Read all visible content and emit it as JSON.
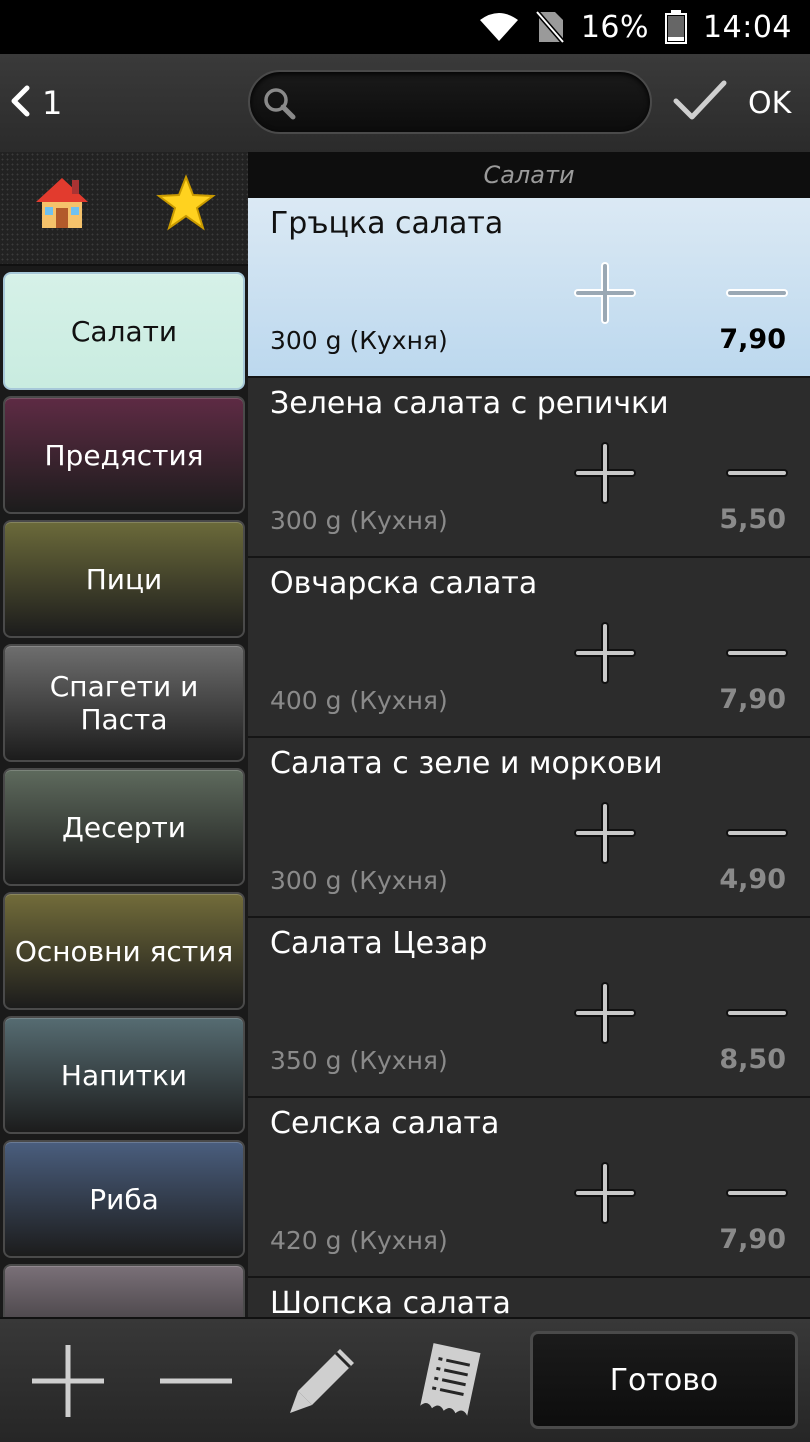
{
  "status_bar": {
    "battery": "16%",
    "time": "14:04"
  },
  "top_bar": {
    "back_count": "1",
    "search_placeholder": "",
    "search_value": "",
    "ok_label": "OK"
  },
  "quick": {
    "home_icon": "house-icon",
    "favorites_icon": "star-icon"
  },
  "categories": [
    {
      "label": "Салати",
      "active": true,
      "color": "#c9ece0"
    },
    {
      "label": "Предястия",
      "color": "#5e2b44"
    },
    {
      "label": "Пици",
      "color": "#6b6a3a"
    },
    {
      "label": "Спагети и Паста",
      "color": "#6e6e6e"
    },
    {
      "label": "Десерти",
      "color": "#5e6a5d"
    },
    {
      "label": "Основни ястия",
      "color": "#726c3a"
    },
    {
      "label": "Напитки",
      "color": "#566c72"
    },
    {
      "label": "Риба",
      "color": "#4a5e7e"
    },
    {
      "label": "",
      "color": "#7a7078"
    }
  ],
  "section": {
    "title": "Салати"
  },
  "items": [
    {
      "name": "Гръцка салата",
      "weight": "300 g (Кухня)",
      "price": "7,90",
      "selected": true
    },
    {
      "name": "Зелена салата с репички",
      "weight": "300 g (Кухня)",
      "price": "5,50"
    },
    {
      "name": "Овчарска салата",
      "weight": "400 g (Кухня)",
      "price": "7,90"
    },
    {
      "name": "Салата с зеле и моркови",
      "weight": "300 g (Кухня)",
      "price": "4,90"
    },
    {
      "name": "Салата Цезар",
      "weight": "350 g (Кухня)",
      "price": "8,50"
    },
    {
      "name": "Селска салата",
      "weight": "420 g (Кухня)",
      "price": "7,90"
    },
    {
      "name": "Шопска салата",
      "weight": "",
      "price": ""
    }
  ],
  "bottom_bar": {
    "add_icon": "plus-icon",
    "remove_icon": "minus-icon",
    "edit_icon": "pencil-icon",
    "receipt_icon": "receipt-icon",
    "done_label": "Готово"
  },
  "colors": {
    "selected_row": "#c9e0f2",
    "row_bg": "#2c2c2c",
    "header_bg": "#0e0e0e"
  }
}
